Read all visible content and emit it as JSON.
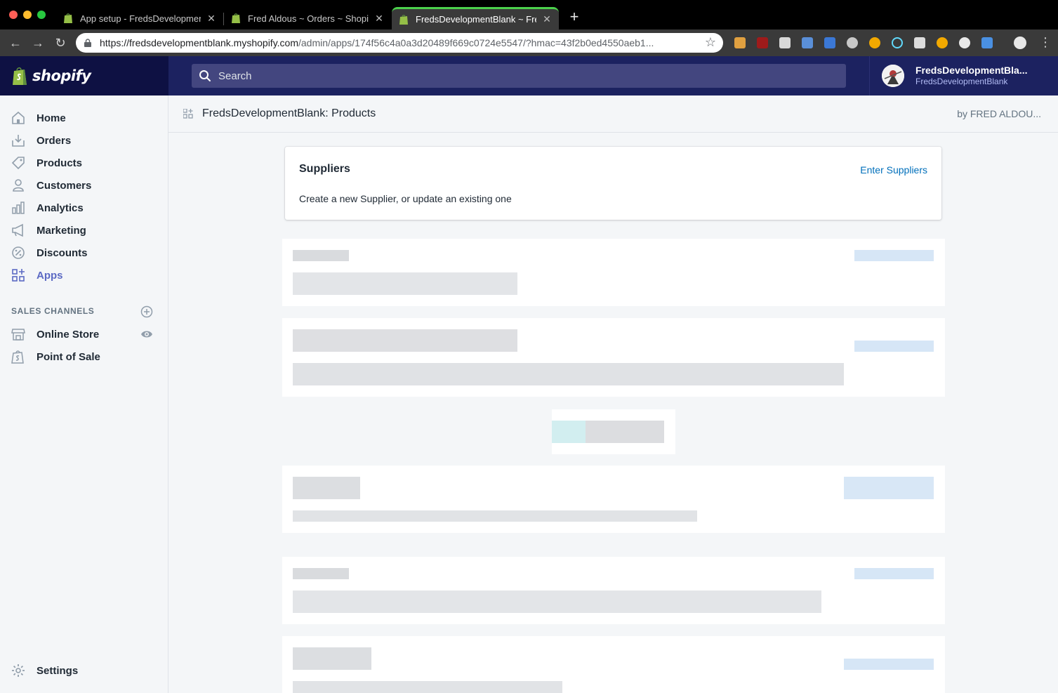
{
  "browser": {
    "tabs": [
      {
        "title": "App setup - FredsDevelopmentBlank",
        "active": false
      },
      {
        "title": "Fred Aldous ~ Orders ~ Shopify",
        "active": false
      },
      {
        "title": "FredsDevelopmentBlank ~ Fred Aldous",
        "active": true
      }
    ],
    "url_host": "https://fredsdevelopmentblank.myshopify.com",
    "url_path": "/admin/apps/174f56c4a0a3d20489f669c0724e5547/?hmac=43f2b0ed4550aeb1..."
  },
  "topbar": {
    "logo_text": "shopify",
    "search_placeholder": "Search",
    "store_name": "FredsDevelopmentBla...",
    "store_sub": "FredsDevelopmentBlank"
  },
  "sidebar": {
    "items": [
      {
        "label": "Home",
        "icon": "home-icon"
      },
      {
        "label": "Orders",
        "icon": "orders-icon"
      },
      {
        "label": "Products",
        "icon": "tag-icon"
      },
      {
        "label": "Customers",
        "icon": "person-icon"
      },
      {
        "label": "Analytics",
        "icon": "bar-chart-icon"
      },
      {
        "label": "Marketing",
        "icon": "megaphone-icon"
      },
      {
        "label": "Discounts",
        "icon": "discount-icon"
      },
      {
        "label": "Apps",
        "icon": "apps-icon",
        "active": true
      }
    ],
    "sales_channels_heading": "SALES CHANNELS",
    "channels": [
      {
        "label": "Online Store",
        "icon": "store-icon"
      },
      {
        "label": "Point of Sale",
        "icon": "shopify-bag-icon"
      }
    ],
    "settings_label": "Settings"
  },
  "app": {
    "title": "FredsDevelopmentBlank: Products",
    "by": "by FRED ALDOU..."
  },
  "suppliers_card": {
    "title": "Suppliers",
    "link": "Enter Suppliers",
    "description": "Create a new Supplier, or update an existing one"
  },
  "colors": {
    "brand_nav": "#1c2260",
    "logo_bg": "#0e1143",
    "active_nav": "#5c6ac4",
    "link": "#006fbb"
  }
}
